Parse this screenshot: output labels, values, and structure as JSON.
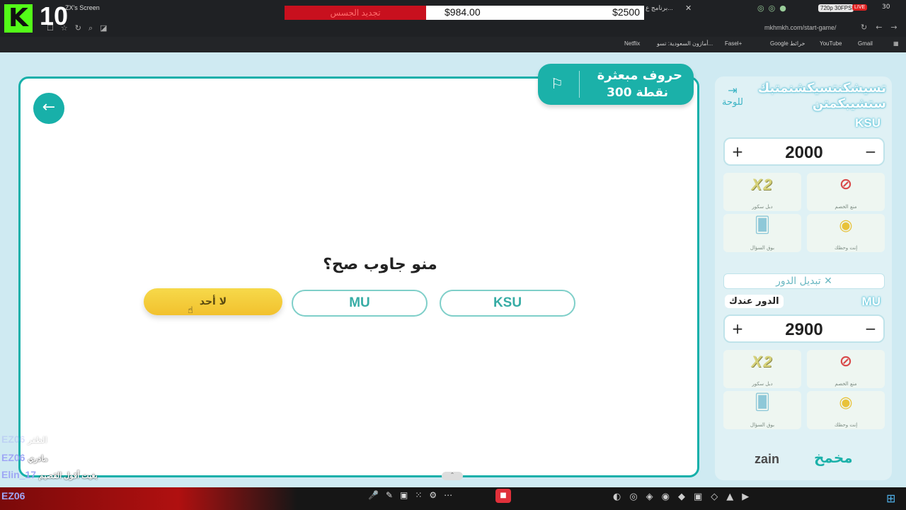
{
  "stream": {
    "logo": "K",
    "number": "10",
    "tab_title": "ZX's Screen",
    "donation_label": "تجديد الجسس",
    "donation_current": "$984.00",
    "donation_goal": "$2500",
    "tab_right": "برنامج ع...",
    "resolution": "720p 30FPS",
    "live": "LIVE",
    "viewers": "30",
    "url": "mkhmkh.com/start-game/"
  },
  "bookmarks": {
    "netflix": "Netflix",
    "amazon": "أمازون السعودية: تسو...",
    "fasel": "Fasel+",
    "maps": "Google خرائط",
    "youtube": "YouTube",
    "gmail": "Gmail"
  },
  "game": {
    "category_name": "حروف مبعثرة",
    "category_points": "300 نقطة",
    "question": "منو جاوب صح؟",
    "answers": {
      "team1": "KSU",
      "team2": "MU",
      "nobody": "لا أحد"
    }
  },
  "panel": {
    "game_name": "تسيشكنتسيكشنمتبك ستشيبكمتن",
    "board_link": "للوحة",
    "team1": {
      "name": "KSU",
      "score": "2000",
      "helpers": {
        "double": "دبل سكور",
        "block": "منع الخصم",
        "call": "بوق السؤال",
        "spin": "إنت وحظك"
      }
    },
    "swap_turn": "تبديل الدور",
    "team2": {
      "name": "MU",
      "turn_label": "الدور عندك",
      "score": "2900",
      "helpers": {
        "double": "دبل سكور",
        "block": "منع الخصم",
        "call": "بوق السؤال",
        "spin": "إنت وحظك"
      }
    },
    "sponsor": "zain",
    "sponsor_logo": "مخمخ"
  },
  "chat": [
    {
      "user": "EZ06",
      "msg": "الظفر"
    },
    {
      "user": "EZ06",
      "msg": "مادري"
    },
    {
      "user": "Elin_17",
      "msg": "بغيت أقول القصيم"
    },
    {
      "user": "EZ06",
      "msg": ""
    }
  ],
  "colors": {
    "teal": "#18b0a9",
    "yellow": "#f4cd3a",
    "panel_bg": "#dff1f5"
  }
}
